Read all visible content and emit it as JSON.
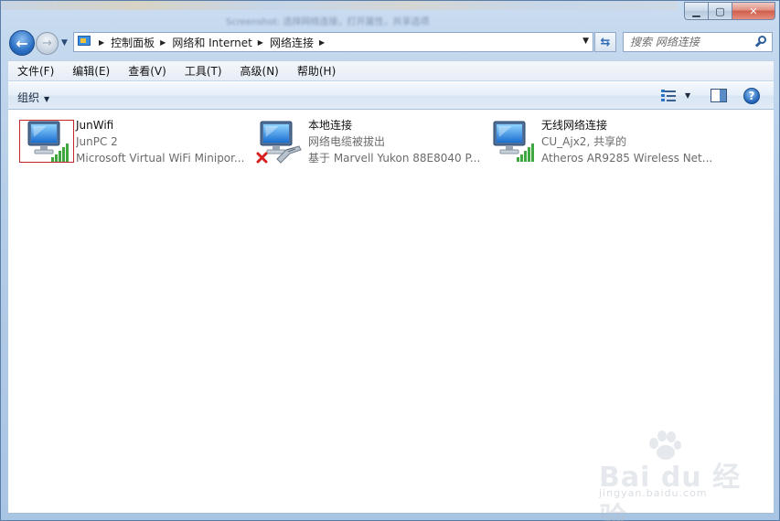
{
  "window": {
    "caption_text": "Screenshot: 选择网络连接，打开属性，共享选项",
    "min_label": "▁",
    "max_label": "▢",
    "close_label": "✕"
  },
  "address_bar": {
    "breadcrumbs": [
      "控制面板",
      "网络和 Internet",
      "网络连接"
    ],
    "search_placeholder": "搜索 网络连接"
  },
  "menu": {
    "items": [
      "文件(F)",
      "编辑(E)",
      "查看(V)",
      "工具(T)",
      "高级(N)",
      "帮助(H)"
    ]
  },
  "command_bar": {
    "organize_label": "组织"
  },
  "connections": [
    {
      "name": "JunWifi",
      "status": "JunPC  2",
      "device": "Microsoft Virtual WiFi Minipor...",
      "icon": "wireless-network-icon",
      "selected": true
    },
    {
      "name": "本地连接",
      "status": "网络电缆被拔出",
      "device": "基于 Marvell Yukon 88E8040 P...",
      "icon": "wired-network-disconnected-icon",
      "selected": false
    },
    {
      "name": "无线网络连接",
      "status": "CU_Ajx2, 共享的",
      "device": "Atheros AR9285 Wireless Net...",
      "icon": "wireless-network-icon",
      "selected": false
    }
  ],
  "watermark": {
    "brand": "Bai du 经验",
    "url": "jingyan.baidu.com"
  },
  "colors": {
    "signal_green": "#3ea83e",
    "error_red": "#d62020",
    "selection_border": "#c1272d"
  }
}
